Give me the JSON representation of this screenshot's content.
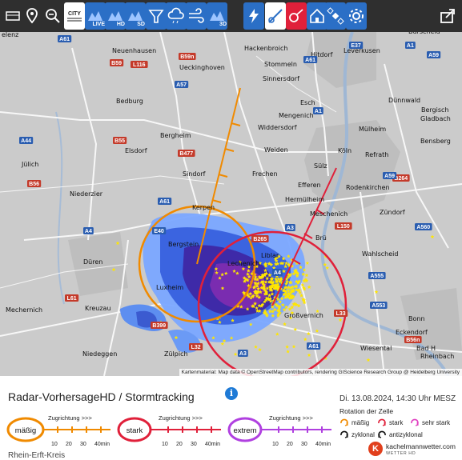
{
  "toolbar": {
    "buttons": [
      {
        "name": "layers-button",
        "icon": "layers-icon"
      },
      {
        "name": "location-button",
        "icon": "location-pin-icon"
      },
      {
        "name": "zoom-out-button",
        "icon": "zoom-out-icon"
      },
      {
        "name": "city-toggle-button",
        "icon": "city-label-icon",
        "label": "CITY"
      },
      {
        "name": "live-radar-button",
        "icon": "radar-live-icon",
        "label": "LIVE"
      },
      {
        "name": "radar-hd-button",
        "icon": "radar-hd-icon",
        "label": "HD"
      },
      {
        "name": "radar-sd-button",
        "icon": "radar-sd-icon",
        "label": "SD"
      },
      {
        "name": "hail-button",
        "icon": "funnel-icon"
      },
      {
        "name": "precip-type-button",
        "icon": "cloud-rain-icon"
      },
      {
        "name": "wind-button",
        "icon": "wind-icon"
      },
      {
        "name": "radar-3d-button",
        "icon": "radar-3d-icon",
        "label": "3D"
      },
      {
        "name": "lightning-button",
        "icon": "lightning-icon"
      },
      {
        "name": "stormtracking-button",
        "icon": "storm-track-icon"
      },
      {
        "name": "storm-rotation-button",
        "icon": "storm-rotation-icon"
      },
      {
        "name": "warnings-button",
        "icon": "house-warning-icon"
      },
      {
        "name": "satellite-button",
        "icon": "satellite-icon"
      },
      {
        "name": "settings-button",
        "icon": "gear-icon"
      },
      {
        "name": "share-button",
        "icon": "share-icon"
      }
    ]
  },
  "map": {
    "cities": [
      {
        "name": "Selenz",
        "label": "elenz"
      },
      {
        "name": "Neuenhausen",
        "label": "Neuenhausen"
      },
      {
        "name": "Hackenbroich",
        "label": "Hackenbroich"
      },
      {
        "name": "Hitdorf",
        "label": "Hitdorf"
      },
      {
        "name": "Leverkusen",
        "label": "Leverkusen"
      },
      {
        "name": "Burscheid",
        "label": "Burscheid"
      },
      {
        "name": "Ueckinghoven",
        "label": "Ueckinghoven"
      },
      {
        "name": "Stommeln",
        "label": "Stommeln"
      },
      {
        "name": "Sinnersdorf",
        "label": "Sinnersdorf"
      },
      {
        "name": "Bedburg",
        "label": "Bedburg"
      },
      {
        "name": "Esch",
        "label": "Esch"
      },
      {
        "name": "Dünnwald",
        "label": "Dünnwald"
      },
      {
        "name": "Bergisch Gladbach",
        "label": "Bergisch"
      },
      {
        "name": "Gladbach",
        "label": "Gladbach"
      },
      {
        "name": "Mengenich",
        "label": "Mengenich"
      },
      {
        "name": "Mülheim",
        "label": "Mülheim"
      },
      {
        "name": "Widdersdorf",
        "label": "Widdersdorf"
      },
      {
        "name": "Bergheim",
        "label": "Bergheim"
      },
      {
        "name": "Elsdorf",
        "label": "Elsdorf"
      },
      {
        "name": "Weiden",
        "label": "Weiden"
      },
      {
        "name": "Köln",
        "label": "Köln"
      },
      {
        "name": "Refrath",
        "label": "Refrath"
      },
      {
        "name": "Bensberg",
        "label": "Bensberg"
      },
      {
        "name": "Jülich",
        "label": "Jülich"
      },
      {
        "name": "Sindorf",
        "label": "Sindorf"
      },
      {
        "name": "Frechen",
        "label": "Frechen"
      },
      {
        "name": "Sülz",
        "label": "Sülz"
      },
      {
        "name": "Niederzier",
        "label": "Niederzier"
      },
      {
        "name": "Efferen",
        "label": "Efferen"
      },
      {
        "name": "Porz",
        "label": "Rodenkirchen"
      },
      {
        "name": "Hermülheim",
        "label": "Hermülheim"
      },
      {
        "name": "Kerpen",
        "label": "Kerpen"
      },
      {
        "name": "Meschenich",
        "label": "Meschenich"
      },
      {
        "name": "Zündorf",
        "label": "Zündorf"
      },
      {
        "name": "Brühl",
        "label": "Brü"
      },
      {
        "name": "Wahlscheid",
        "label": "Wahlscheid"
      },
      {
        "name": "Düren",
        "label": "Düren"
      },
      {
        "name": "Lechenich",
        "label": "Lechenich"
      },
      {
        "name": "Liblar",
        "label": "Liblar"
      },
      {
        "name": "Luxheim",
        "label": "Luxheim"
      },
      {
        "name": "Kreuzau",
        "label": "Kreuzau"
      },
      {
        "name": "Bonn",
        "label": "Bonn"
      },
      {
        "name": "Großvernich",
        "label": "Großvernich"
      },
      {
        "name": "Niedeggen",
        "label": "Niedeggen"
      },
      {
        "name": "Zülpich",
        "label": "Zülpich"
      },
      {
        "name": "Eckendorf",
        "label": "Eckendorf"
      },
      {
        "name": "Bad Honnef",
        "label": "Bad H"
      },
      {
        "name": "Mechernich",
        "label": "Mechernich"
      },
      {
        "name": "Rheinbach",
        "label": "Rheinbach"
      },
      {
        "name": "Bergstein",
        "label": "Bergstein"
      },
      {
        "name": "Wiesental",
        "label": "Wiesental"
      }
    ],
    "roads": [
      "A61",
      "B59",
      "L116",
      "B59n",
      "A57",
      "A1",
      "B477",
      "B55",
      "A44",
      "B56",
      "A4",
      "A61",
      "E40",
      "B264",
      "A59",
      "A555",
      "L150",
      "A560",
      "A3",
      "B265",
      "L61",
      "B399",
      "L33",
      "L32",
      "B56n",
      "A1",
      "E37",
      "A61",
      "A59",
      "A553",
      "A3",
      "A61",
      "A4"
    ],
    "attribution": "Kartenmaterial: Map data © OpenStreetMap contributors, rendering GIScience Research Group @ Heidelberg University"
  },
  "legend": {
    "title": "Radar-VorhersageHD / Stormtracking",
    "levels": [
      {
        "label": "mäßig",
        "color": "#f08a00"
      },
      {
        "label": "stark",
        "color": "#e0203a"
      },
      {
        "label": "extrem",
        "color": "#b040e0"
      }
    ],
    "direction_label": "Zugrichtung >>>",
    "ticks": [
      "10",
      "20",
      "30",
      "40min"
    ],
    "date": "Di. 13.08.2024, 14:30 Uhr MESZ",
    "rotation_title": "Rotation der Zelle",
    "rotation": [
      {
        "label": "mäßig",
        "color": "#f08a00"
      },
      {
        "label": "stark",
        "color": "#e0203a"
      },
      {
        "label": "sehr stark",
        "color": "#e040c0"
      },
      {
        "label": "zyklonal",
        "color": "#111111"
      },
      {
        "label": "antizyklonal",
        "color": "#111111"
      }
    ],
    "brand": "kachelmannwetter.com",
    "brand_sub": "WETTER HD",
    "brand_logo": "K",
    "region": "Rhein-Erft-Kreis"
  }
}
